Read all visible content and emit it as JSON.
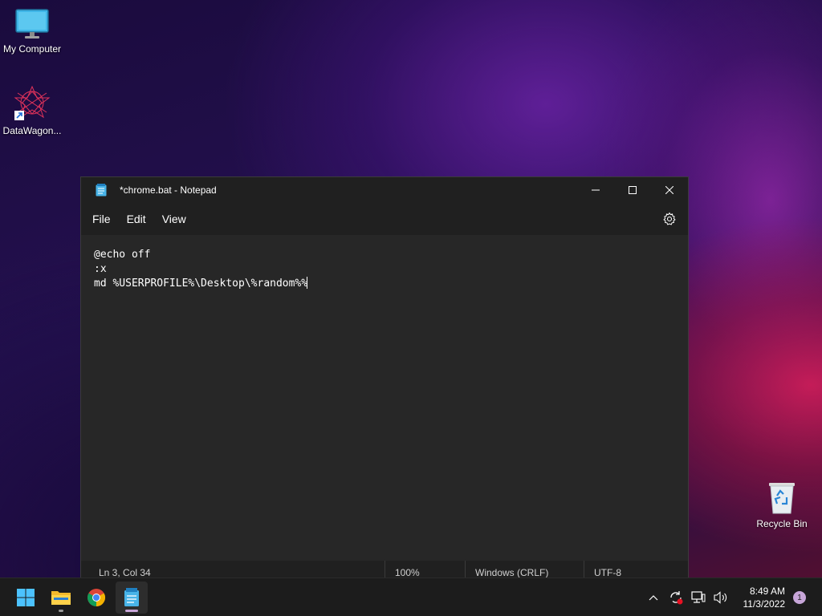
{
  "desktop": {
    "icons": [
      {
        "label": "My Computer",
        "icon": "monitor-icon"
      },
      {
        "label": "DataWagon...",
        "icon": "datawagon-icon"
      },
      {
        "label": "Recycle Bin",
        "icon": "recycle-bin-icon"
      }
    ]
  },
  "window": {
    "title": "*chrome.bat - Notepad",
    "menu": [
      "File",
      "Edit",
      "View"
    ],
    "content_lines": [
      "@echo off",
      ":x",
      "md %USERPROFILE%\\Desktop\\%random%%"
    ],
    "status": {
      "position": "Ln 3, Col 34",
      "zoom": "100%",
      "line_ending": "Windows (CRLF)",
      "encoding": "UTF-8"
    }
  },
  "taskbar": {
    "apps": [
      "start-icon",
      "file-explorer-icon",
      "chrome-icon",
      "notepad-icon"
    ],
    "time": "8:49 AM",
    "date": "11/3/2022",
    "notification_count": "1"
  },
  "colors": {
    "window_bg": "#272727",
    "titlebar_bg": "#202020",
    "taskbar_bg": "#1c1c1c",
    "accent": "#c7a6d9"
  }
}
